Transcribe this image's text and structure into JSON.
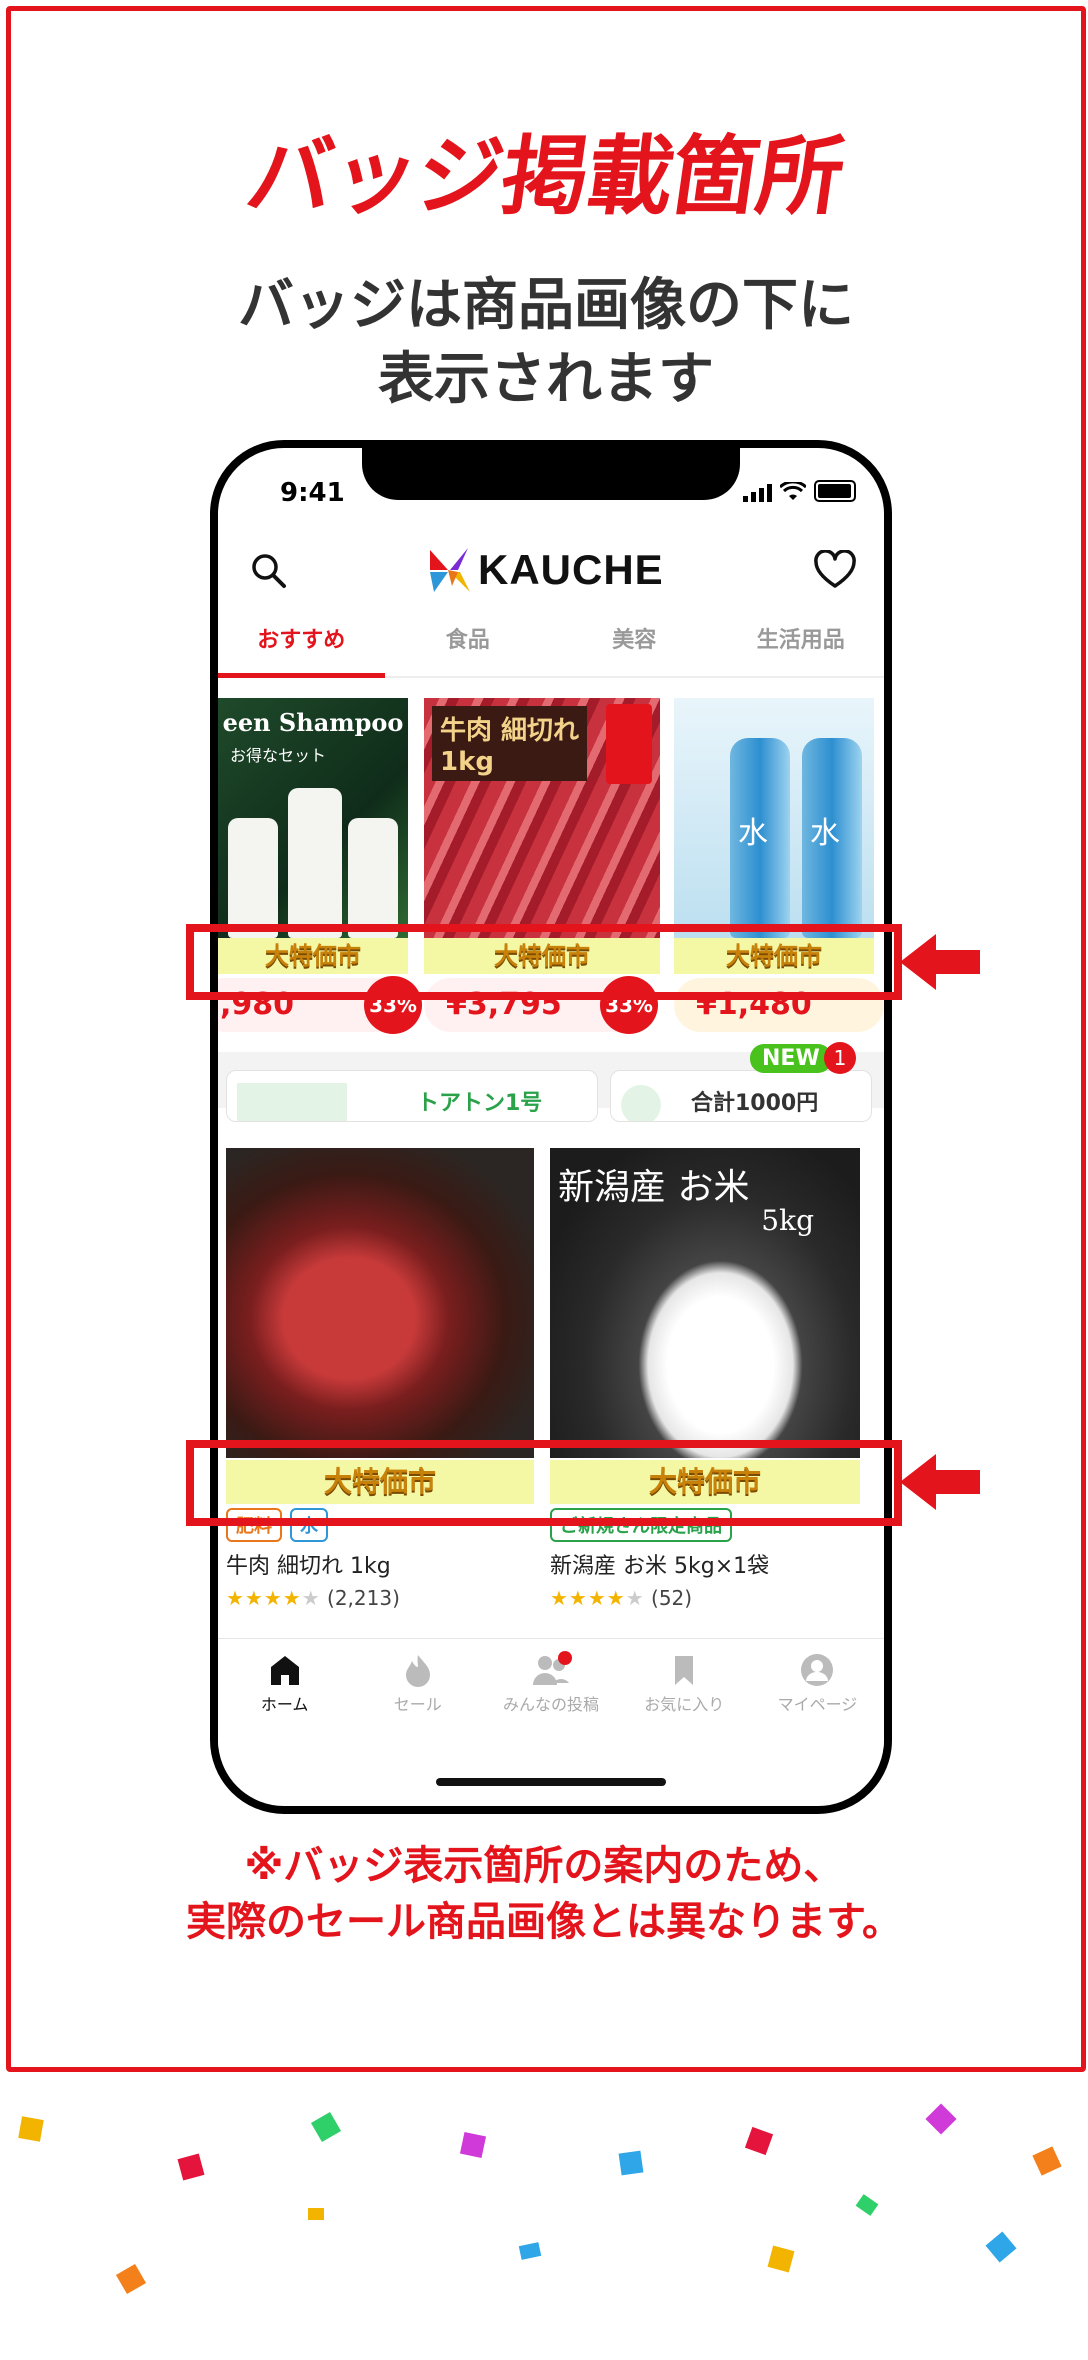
{
  "headline": "バッジ掲載箇所",
  "subtitle": "バッジは商品画像の下に\n表示されます",
  "note": "※バッジ表示箇所の案内のため、\n実際のセール商品画像とは異なります。",
  "phone": {
    "status_time": "9:41",
    "app_logo": "KAUCHE",
    "tabs": [
      {
        "label": "おすすめ",
        "active": true
      },
      {
        "label": "食品",
        "active": false
      },
      {
        "label": "美容",
        "active": false
      },
      {
        "label": "生活用品",
        "active": false
      }
    ],
    "row1": {
      "products": [
        {
          "image_text": "een Shampoo",
          "image_subtext": "お得なセット",
          "badge": "大特価市",
          "price": ",980",
          "discount": "33%"
        },
        {
          "image_text": "牛肉 細切れ",
          "image_subtext": "1kg",
          "badge": "大特価市",
          "price": "¥3,795",
          "discount": "33%"
        },
        {
          "image_text": "水",
          "badge": "大特価市",
          "price": "¥1,480"
        }
      ]
    },
    "promo": {
      "card1_text": "トアトン1号",
      "card2_text": "合計1000円",
      "new_badge": "NEW",
      "notif_count": "1"
    },
    "row2": {
      "products": [
        {
          "badge": "大特価市",
          "chips": [
            {
              "label": "肥料",
              "color": "orange"
            },
            {
              "label": "水",
              "color": "blue"
            }
          ],
          "name": "牛肉 細切れ 1kg",
          "rating_count": "(2,213)",
          "stars": 4
        },
        {
          "image_text": "新潟産 お米",
          "image_subtext": "5kg",
          "badge": "大特価市",
          "chips": [
            {
              "label": "ご新規さん限定商品",
              "color": "green"
            }
          ],
          "name": "新潟産 お米 5kg×1袋",
          "rating_count": "(52)",
          "stars": 4
        }
      ]
    },
    "bottom_nav": [
      {
        "label": "ホーム",
        "icon": "home-icon",
        "active": true
      },
      {
        "label": "セール",
        "icon": "fire-icon",
        "active": false
      },
      {
        "label": "みんなの投稿",
        "icon": "people-icon",
        "active": false
      },
      {
        "label": "お気に入り",
        "icon": "bookmark-icon",
        "active": false
      },
      {
        "label": "マイページ",
        "icon": "user-icon",
        "active": false
      }
    ]
  },
  "colors": {
    "accent_red": "#e4141c",
    "badge_bg": "#f4f7a4",
    "badge_text": "#c8820a",
    "new_green": "#49c21e"
  }
}
